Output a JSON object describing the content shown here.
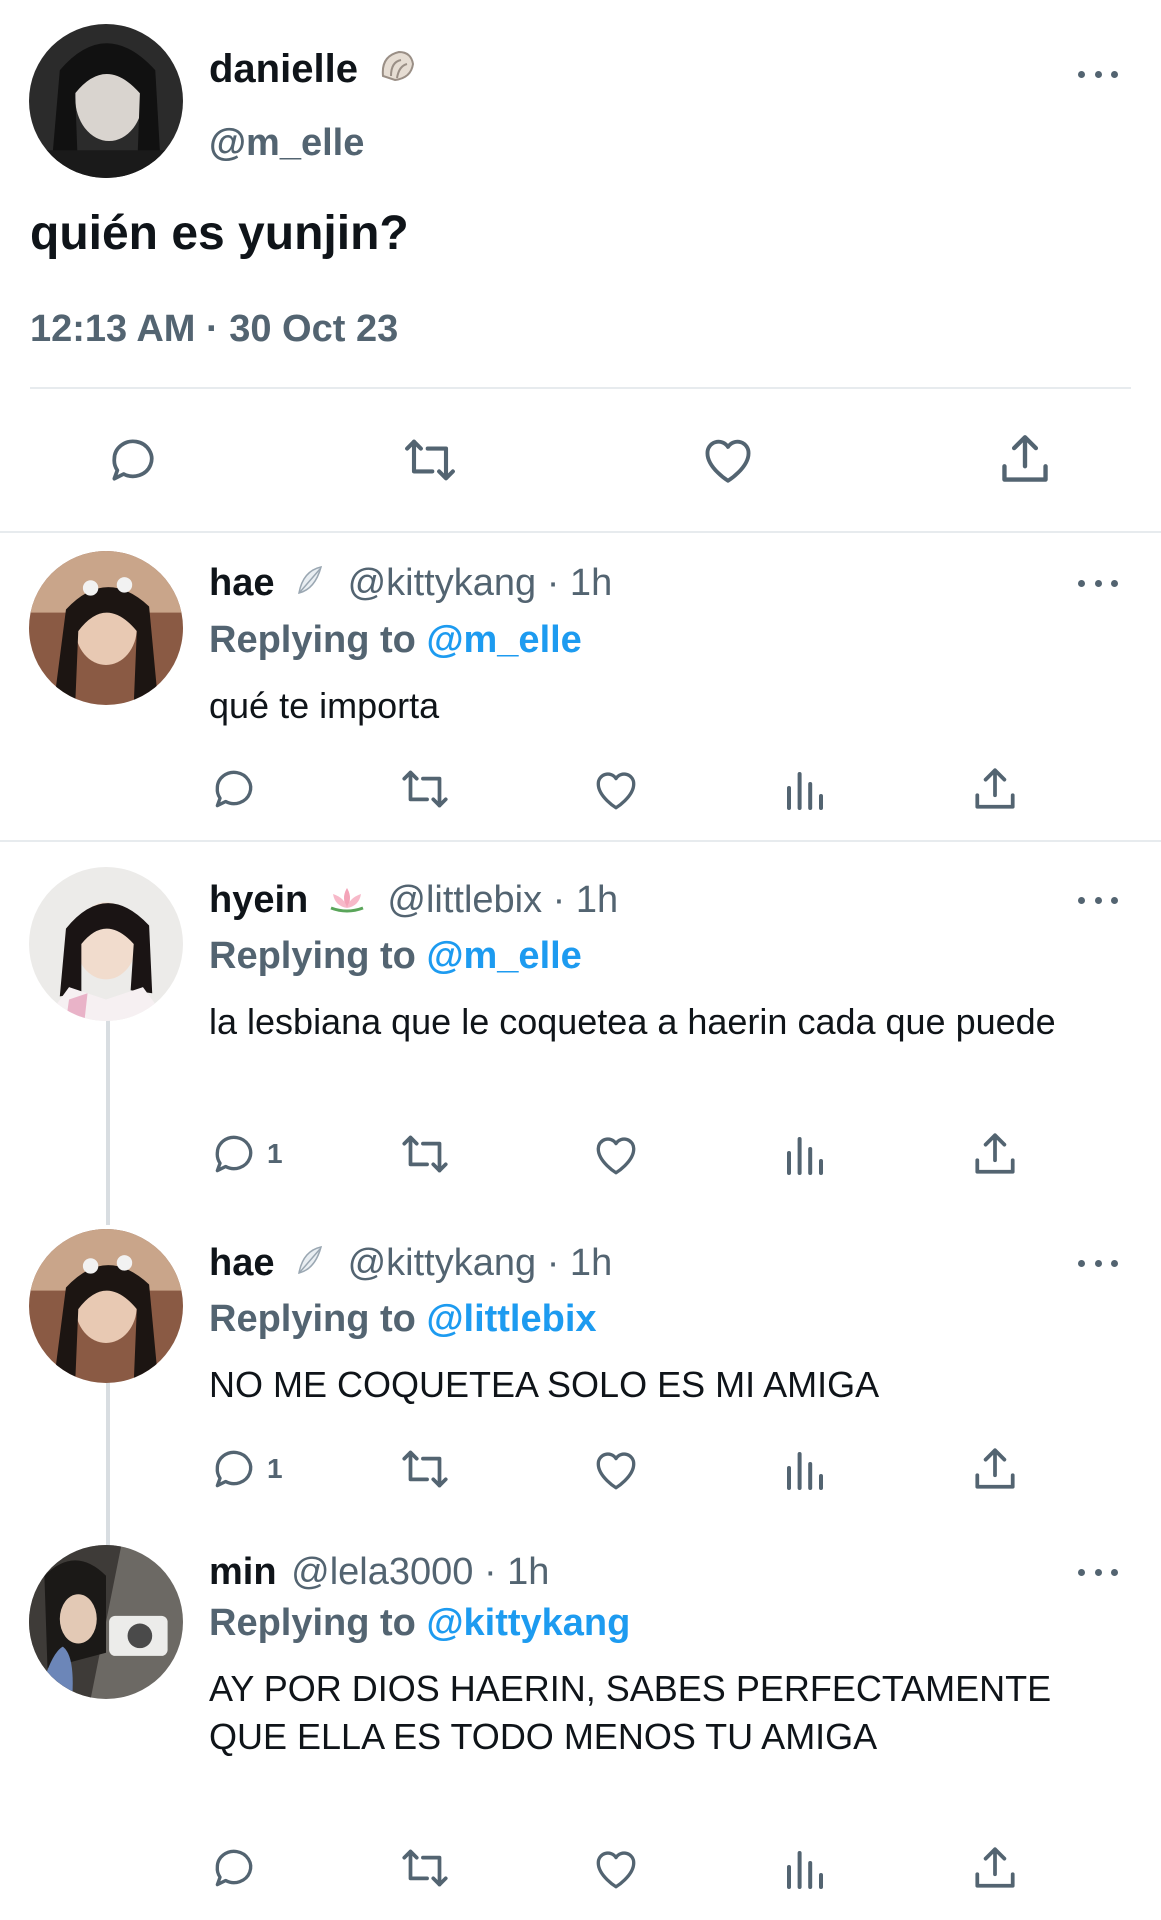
{
  "main_tweet": {
    "display_name": "danielle",
    "name_emoji": "shell-emoji",
    "handle": "@m_elle",
    "text": "quién es yunjin?",
    "time": "12:13 AM",
    "separator": "·",
    "date": "30 Oct 23",
    "actions": [
      "reply-icon",
      "retweet-icon",
      "like-icon",
      "share-icon"
    ]
  },
  "replies": [
    {
      "display_name": "hae",
      "name_emoji": "feather-emoji",
      "handle": "@kittykang",
      "time": "· 1h",
      "replying_label": "Replying to",
      "replying_to": "@m_elle",
      "text": "qué te importa",
      "reply_count": ""
    },
    {
      "display_name": "hyein",
      "name_emoji": "lotus-emoji",
      "handle": "@littlebix",
      "time": "· 1h",
      "replying_label": "Replying to",
      "replying_to": "@m_elle",
      "text": "la lesbiana que le coquetea a haerin cada que puede",
      "reply_count": "1"
    },
    {
      "display_name": "hae",
      "name_emoji": "feather-emoji",
      "handle": "@kittykang",
      "time": "· 1h",
      "replying_label": "Replying to",
      "replying_to": "@littlebix",
      "text": "NO ME COQUETEA SOLO ES MI AMIGA",
      "reply_count": "1"
    },
    {
      "display_name": "min",
      "name_emoji": "",
      "handle": "@lela3000",
      "time": "· 1h",
      "replying_label": "Replying to",
      "replying_to": "@kittykang",
      "text": "AY POR DIOS HAERIN, SABES PERFECTAMENTE QUE ELLA ES TODO MENOS TU AMIGA",
      "reply_count": ""
    }
  ],
  "colors": {
    "text": "#0f1419",
    "secondary": "#536471",
    "link": "#1d9bf0",
    "divider": "#e7ebee"
  }
}
